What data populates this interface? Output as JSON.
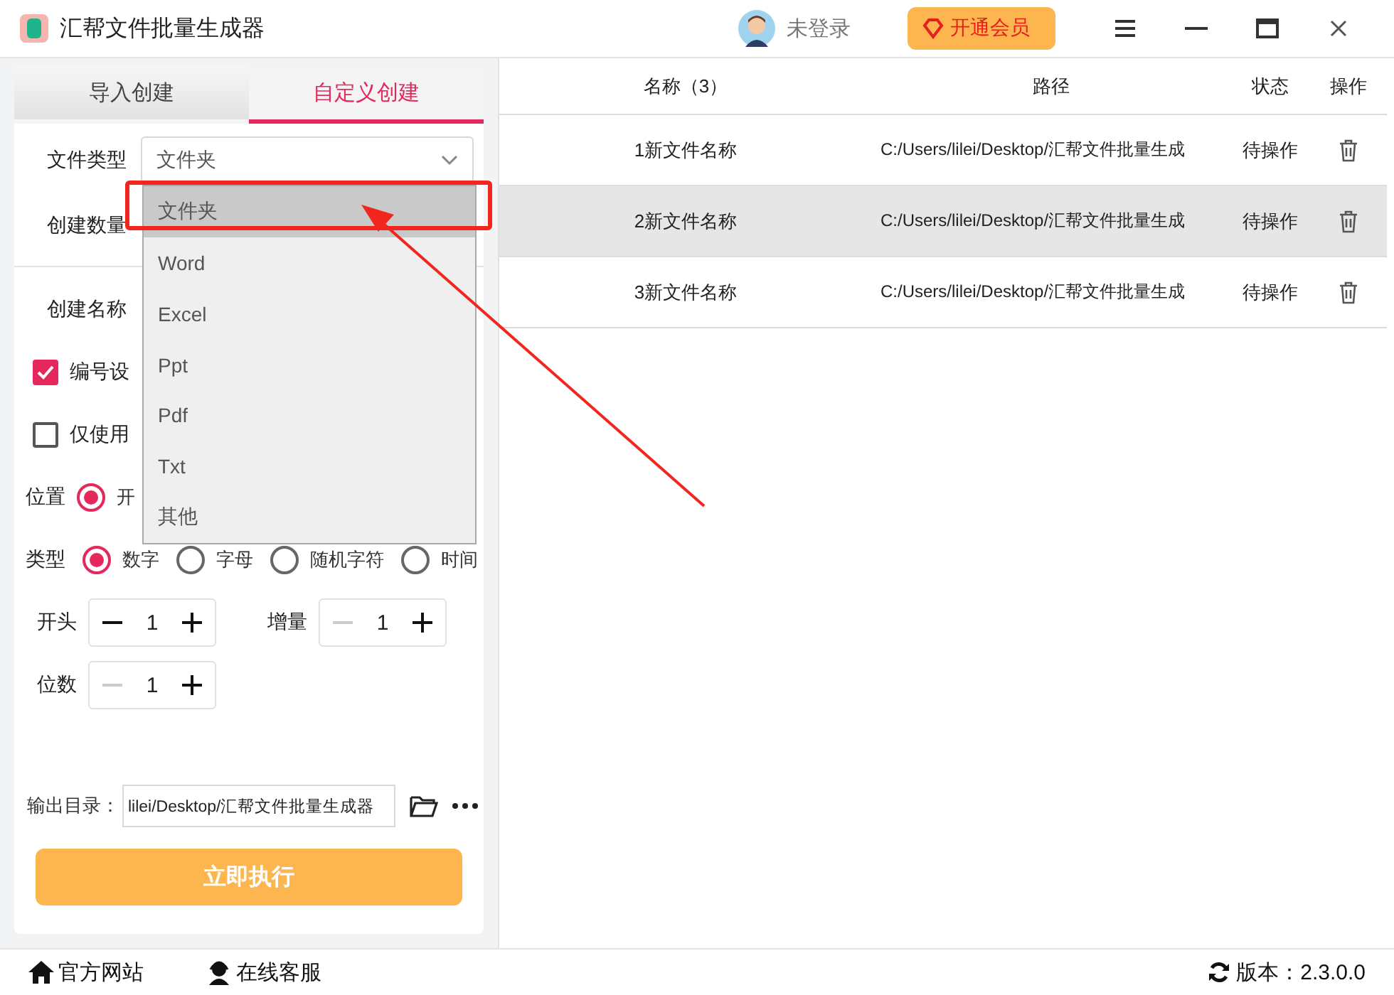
{
  "window": {
    "title": "汇帮文件批量生成器",
    "user": "未登录",
    "vip_button": "开通会员"
  },
  "tabs": [
    {
      "label": "导入创建",
      "selected": false
    },
    {
      "label": "自定义创建",
      "selected": true
    }
  ],
  "form": {
    "file_type": {
      "label": "文件类型",
      "value": "文件夹"
    },
    "count": {
      "label": "创建数量"
    },
    "name": {
      "label": "创建名称"
    },
    "checkboxes": [
      {
        "label": "编号设",
        "checked": true
      },
      {
        "label": "仅使用",
        "checked": false
      }
    ],
    "position": {
      "label": "位置",
      "options": [
        {
          "label": "开",
          "selected": true
        }
      ]
    },
    "type": {
      "label": "类型",
      "options": [
        {
          "label": "数字",
          "selected": true
        },
        {
          "label": "字母",
          "selected": false
        },
        {
          "label": "随机字符",
          "selected": false
        },
        {
          "label": "时间",
          "selected": false
        }
      ]
    },
    "steppers": [
      {
        "label": "开头",
        "value": "1",
        "minus_disabled": false
      },
      {
        "label": "增量",
        "value": "1",
        "minus_disabled": true
      },
      {
        "label": "位数",
        "value": "1",
        "minus_disabled": true
      }
    ],
    "output": {
      "label": "输出目录：",
      "value": "lilei/Desktop/汇帮文件批量生成器"
    },
    "run_button": "立即执行"
  },
  "dropdown": {
    "options": [
      {
        "label": "文件夹",
        "selected": true
      },
      {
        "label": "Word",
        "selected": false
      },
      {
        "label": "Excel",
        "selected": false
      },
      {
        "label": "Ppt",
        "selected": false
      },
      {
        "label": "Pdf",
        "selected": false
      },
      {
        "label": "Txt",
        "selected": false
      },
      {
        "label": "其他",
        "selected": false
      }
    ]
  },
  "table": {
    "columns": [
      "名称（3）",
      "路径",
      "状态",
      "操作"
    ],
    "rows": [
      {
        "name": "1新文件名称",
        "path": "C:/Users/lilei/Desktop/汇帮文件批量生成",
        "status": "待操作",
        "selected": false
      },
      {
        "name": "2新文件名称",
        "path": "C:/Users/lilei/Desktop/汇帮文件批量生成",
        "status": "待操作",
        "selected": true
      },
      {
        "name": "3新文件名称",
        "path": "C:/Users/lilei/Desktop/汇帮文件批量生成",
        "status": "待操作",
        "selected": false
      }
    ]
  },
  "status_bar": {
    "website": "官方网站",
    "support": "在线客服",
    "version": "版本：2.3.0.0"
  }
}
